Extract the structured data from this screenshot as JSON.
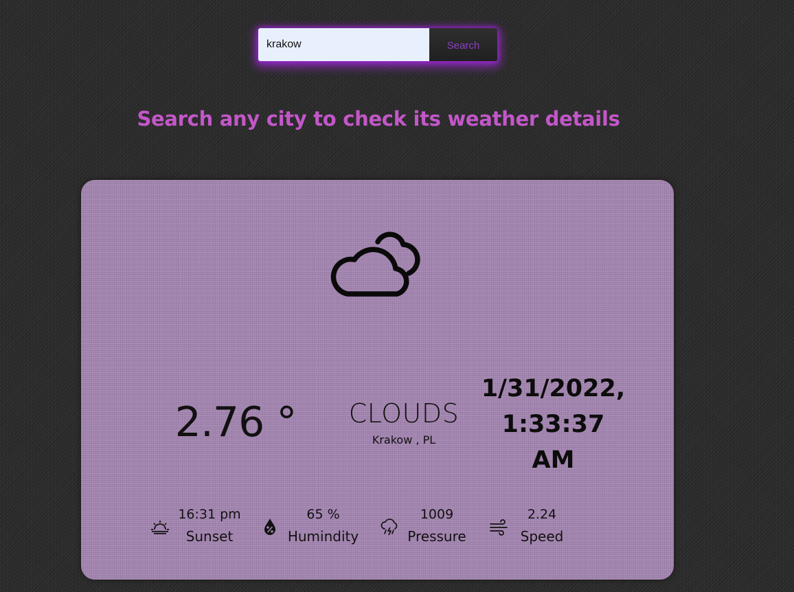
{
  "search": {
    "value": "krakow",
    "button_label": "Search"
  },
  "tagline": "Search any city to check its weather details",
  "weather": {
    "icon": "clouds-icon",
    "temperature": "2.76 °",
    "condition": "CLOUDS",
    "location": "Krakow , PL",
    "date": "1/31/2022,",
    "time": "1:33:37",
    "meridiem": "AM"
  },
  "extras": {
    "sunset": {
      "value": "16:31 pm",
      "label": "Sunset",
      "icon": "sunset-icon"
    },
    "humidity": {
      "value": "65 %",
      "label": "Humindity",
      "icon": "humidity-icon"
    },
    "pressure": {
      "value": "1009",
      "label": "Pressure",
      "icon": "rain-cloud-icon"
    },
    "speed": {
      "value": "2.24",
      "label": "Speed",
      "icon": "wind-icon"
    }
  },
  "colors": {
    "accent": "#c257c8",
    "card": "#a78ab3",
    "background": "#2c2c2c",
    "glow": "#aa28e6"
  }
}
